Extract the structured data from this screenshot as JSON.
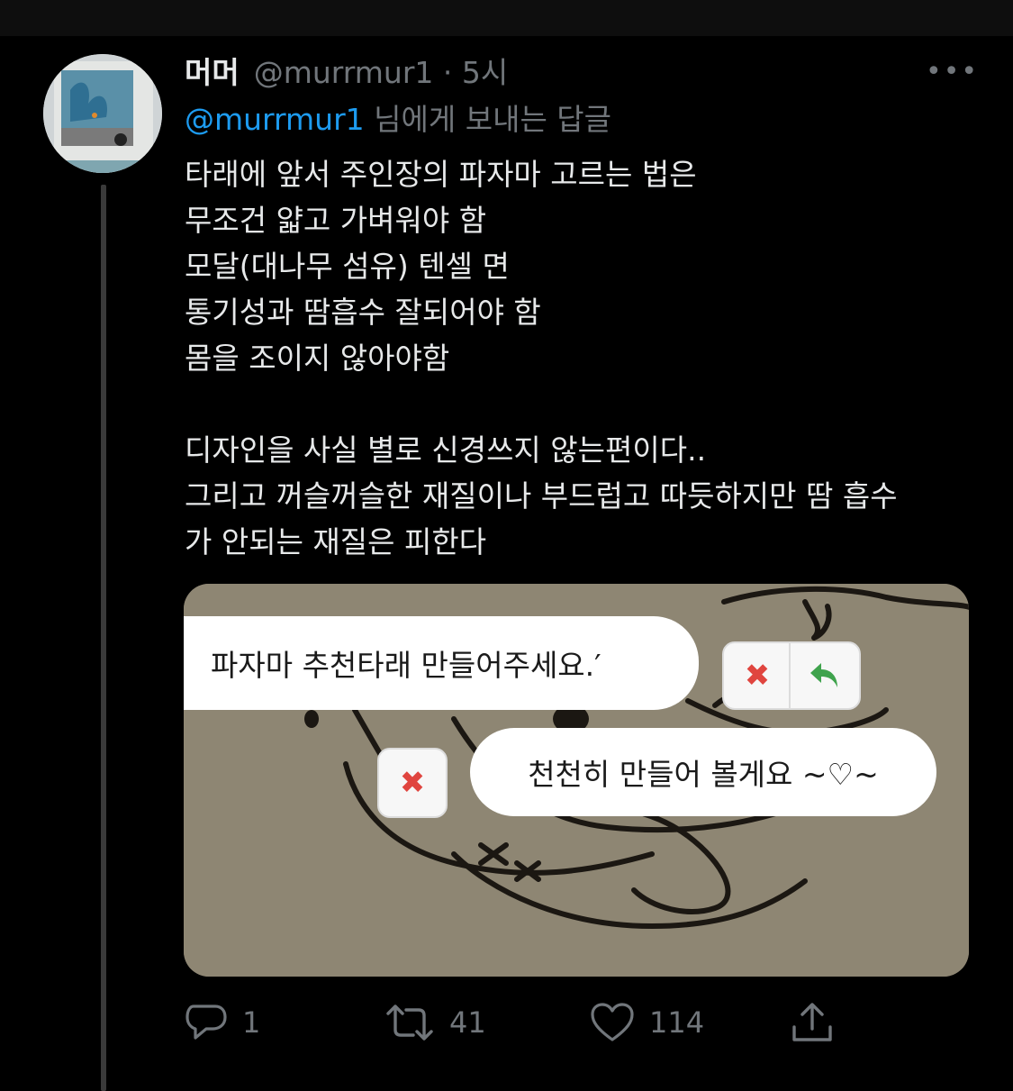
{
  "tweet": {
    "display_name": "머머",
    "handle_and_time": "@murrmur1 · 5시",
    "more_icon": "•••",
    "replying_to": {
      "mention": "@murrmur1",
      "suffix": " 님에게 보내는 답글"
    },
    "body_lines": [
      "타래에 앞서 주인장의 파자마 고르는 법은",
      "무조건 얇고 가벼워야 함",
      "모달(대나무 섬유) 텐셀 면",
      "통기성과 땀흡수 잘되어야 함",
      "몸을 조이지 않아야함",
      "",
      "디자인을 사실 별로 신경쓰지 않는편이다..",
      "그리고 꺼슬꺼슬한 재질이나 부드럽고 따듯하지만 땀 흡수",
      "가 안되는 재질은 피한다"
    ]
  },
  "media": {
    "message1": "파자마 추천타래 만들어주세요.′",
    "message2": "천천히 만들어 볼게요 ~♡~",
    "x_symbol": "✖"
  },
  "actions": {
    "reply": {
      "icon": "comment-icon",
      "count": "1"
    },
    "retweet": {
      "icon": "retweet-icon",
      "count": "41"
    },
    "like": {
      "icon": "heart-icon",
      "count": "114"
    },
    "share": {
      "icon": "share-icon"
    }
  },
  "colors": {
    "background": "#000000",
    "text": "#e7e9ea",
    "muted": "#71767b",
    "link": "#1d9bf0",
    "x_red": "#e0453f",
    "reply_green": "#3fa34d"
  }
}
